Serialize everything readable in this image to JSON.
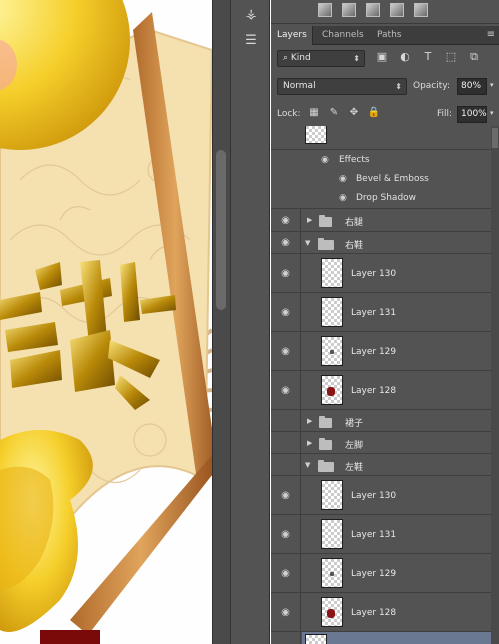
{
  "panel": {
    "tabs": [
      {
        "label": "Layers"
      },
      {
        "label": "Channels"
      },
      {
        "label": "Paths"
      }
    ],
    "filter": {
      "kind_label": "Kind"
    },
    "blend_mode": "Normal",
    "opacity_label": "Opacity:",
    "opacity_value": "80%",
    "lock_label": "Lock:",
    "fill_label": "Fill:",
    "fill_value": "100%"
  },
  "layers": {
    "effects_label": "Effects",
    "effect_items": [
      "Bevel & Emboss",
      "Drop Shadow"
    ],
    "groups": [
      {
        "name": "右腿",
        "state": "collapsed"
      },
      {
        "name": "右鞋",
        "state": "expanded",
        "children": [
          "Layer 130",
          "Layer 131",
          "Layer 129",
          "Layer 128"
        ]
      },
      {
        "name": "裙子",
        "state": "collapsed"
      },
      {
        "name": "左脚",
        "state": "collapsed"
      },
      {
        "name": "左鞋",
        "state": "expanded",
        "children": [
          "Layer 130",
          "Layer 131",
          "Layer 129",
          "Layer 128"
        ]
      }
    ]
  },
  "colors": {
    "panel_bg": "#535353",
    "selected_row": "#6a7891",
    "accent_red": "#8b1414"
  }
}
